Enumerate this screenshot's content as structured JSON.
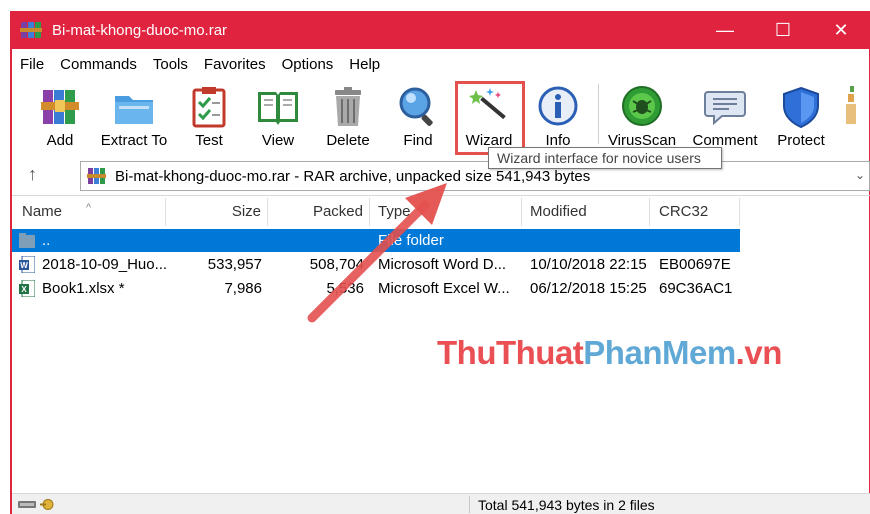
{
  "window": {
    "title": "Bi-mat-khong-duoc-mo.rar",
    "controls": {
      "minimize": "—",
      "maximize": "☐",
      "close": "✕"
    }
  },
  "menu": [
    "File",
    "Commands",
    "Tools",
    "Favorites",
    "Options",
    "Help"
  ],
  "toolbar": {
    "buttons": [
      {
        "label": "Add",
        "icon": "add-archive-icon"
      },
      {
        "label": "Extract To",
        "icon": "extract-folder-icon"
      },
      {
        "label": "Test",
        "icon": "test-clipboard-icon"
      },
      {
        "label": "View",
        "icon": "view-book-icon"
      },
      {
        "label": "Delete",
        "icon": "trash-icon"
      },
      {
        "label": "Find",
        "icon": "magnifier-icon"
      },
      {
        "label": "Wizard",
        "icon": "magic-wand-icon"
      },
      {
        "label": "Info",
        "icon": "info-icon"
      },
      {
        "label": "VirusScan",
        "icon": "virus-scan-icon"
      },
      {
        "label": "Comment",
        "icon": "comment-icon"
      },
      {
        "label": "Protect",
        "icon": "shield-icon"
      }
    ],
    "tooltip": "Wizard interface for novice users"
  },
  "address": {
    "up_icon": "↑",
    "path": "Bi-mat-khong-duoc-mo.rar - RAR archive, unpacked size 541,943 bytes",
    "dropdown": "⌄"
  },
  "columns": {
    "name": "Name",
    "size": "Size",
    "packed": "Packed",
    "type": "Type",
    "modified": "Modified",
    "crc": "CRC32"
  },
  "files": [
    {
      "name": "..",
      "size": "",
      "packed": "",
      "type": "File folder",
      "modified": "",
      "crc": "",
      "icon": "folder-up-icon"
    },
    {
      "name": "2018-10-09_Huo...",
      "size": "533,957",
      "packed": "508,704",
      "type": "Microsoft Word D...",
      "modified": "10/10/2018 22:15",
      "crc": "EB00697E",
      "icon": "word-file-icon"
    },
    {
      "name": "Book1.xlsx *",
      "size": "7,986",
      "packed": "5,536",
      "type": "Microsoft Excel W...",
      "modified": "06/12/2018 15:25",
      "crc": "69C36AC1",
      "icon": "excel-file-icon"
    }
  ],
  "status": {
    "text": "Total 541,943 bytes in 2 files"
  },
  "watermark": {
    "part1": "ThuThuat",
    "part2": "PhanMem",
    "part3": ".vn"
  },
  "colors": {
    "titlebar": "#e0233e",
    "selection": "#0078d7",
    "highlight": "#e4504e"
  }
}
